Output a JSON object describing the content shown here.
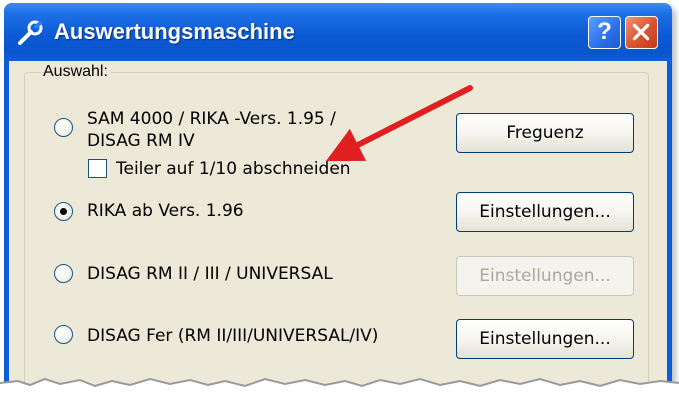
{
  "window": {
    "title": "Auswertungsmaschine",
    "help_label": "?",
    "close_label": "×"
  },
  "group": {
    "legend": "Auswahl:"
  },
  "options": [
    {
      "label_line1": "SAM 4000 / RIKA -Vers. 1.95 /",
      "label_line2": "DISAG RM IV",
      "selected": false,
      "button": "Freguenz",
      "button_enabled": true
    },
    {
      "label": "RIKA ab Vers. 1.96",
      "selected": true,
      "button": "Einstellungen...",
      "button_enabled": true
    },
    {
      "label": "DISAG RM II / III / UNIVERSAL",
      "selected": false,
      "button": "Einstellungen...",
      "button_enabled": false
    },
    {
      "label": "DISAG Fer (RM II/III/UNIVERSAL/IV)",
      "selected": false,
      "button": "Einstellungen...",
      "button_enabled": true
    }
  ],
  "checkbox": {
    "label": "Teiler auf 1/10 abschneiden",
    "checked": false
  },
  "colors": {
    "titlebar": "#0a5fd8",
    "client": "#ece9d8",
    "arrow": "#e02020",
    "close": "#d9532e"
  },
  "icons": [
    "wrench-icon",
    "help-icon",
    "close-icon",
    "annotation-arrow"
  ]
}
